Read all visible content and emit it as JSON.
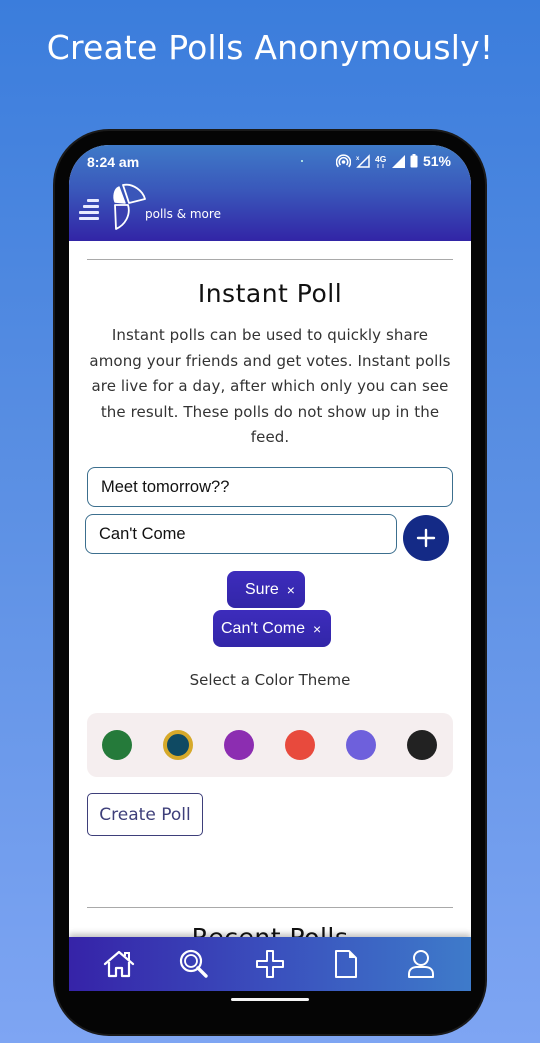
{
  "promo": {
    "title": "Create Polls Anonymously!"
  },
  "statusbar": {
    "time": "8:24 am",
    "battery": "51%",
    "network": "4G",
    "icons": [
      "hotspot-icon",
      "no-data-signal-icon",
      "4g-icon",
      "signal-icon",
      "battery-icon"
    ]
  },
  "appbar": {
    "brand": "polls & more",
    "menu_icon": "hamburger-menu-icon",
    "logo_icon": "polls-logo-icon"
  },
  "instant_poll": {
    "title": "Instant Poll",
    "description": "Instant polls can be used to quickly share among your friends and get votes. Instant polls are live for a day, after which only you can see the result. These polls do not show up in the feed.",
    "question_value": "Meet tomorrow??",
    "option_value": "Can't Come",
    "add_icon": "plus-icon",
    "options": [
      {
        "label": "Sure",
        "remove": "×"
      },
      {
        "label": "Can't Come",
        "remove": "×"
      }
    ],
    "theme_label": "Select a Color Theme",
    "themes": [
      {
        "name": "green",
        "color": "#257a3a",
        "selected": false
      },
      {
        "name": "dark-teal",
        "color": "#0f4a63",
        "selected": true
      },
      {
        "name": "purple",
        "color": "#8c2db1",
        "selected": false
      },
      {
        "name": "red",
        "color": "#e84a3d",
        "selected": false
      },
      {
        "name": "lavender",
        "color": "#6e60dc",
        "selected": false
      },
      {
        "name": "black",
        "color": "#222222",
        "selected": false
      }
    ],
    "selected_ring_color": "#d6a92a",
    "create_button": "Create Poll"
  },
  "recent_polls": {
    "title": "Recent Polls"
  },
  "bottomnav": {
    "items": [
      {
        "name": "home",
        "icon": "home-icon"
      },
      {
        "name": "search",
        "icon": "search-icon"
      },
      {
        "name": "create",
        "icon": "plus-icon"
      },
      {
        "name": "documents",
        "icon": "document-icon"
      },
      {
        "name": "profile",
        "icon": "user-icon"
      }
    ]
  },
  "colors": {
    "background": "#3b7ddc",
    "appbar_accent": "#3225a6",
    "chip": "#3226a8",
    "add_button": "#142a86"
  }
}
